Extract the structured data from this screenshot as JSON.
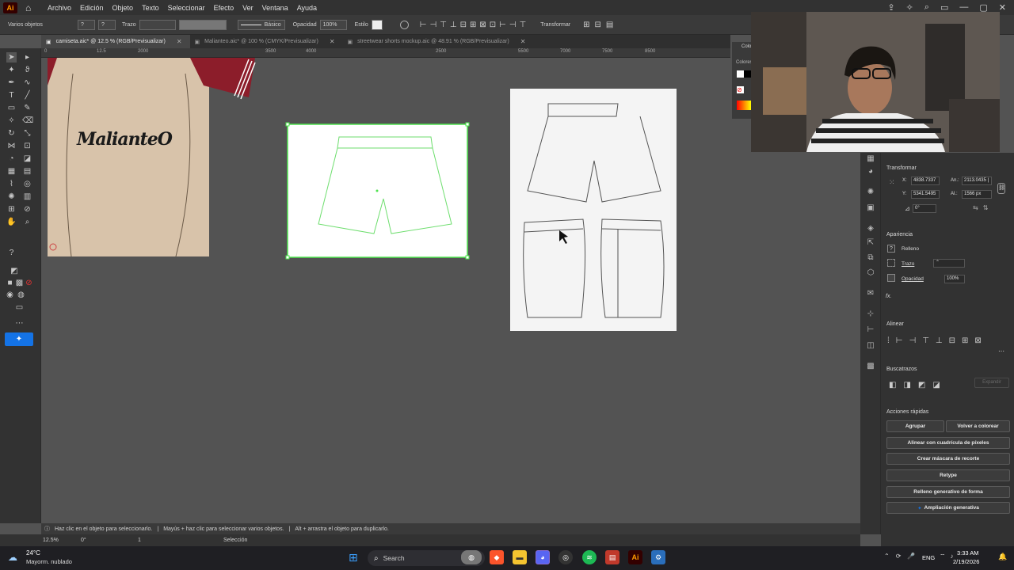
{
  "app": {
    "logo": "Ai",
    "menu": [
      "Archivo",
      "Edición",
      "Objeto",
      "Texto",
      "Seleccionar",
      "Efecto",
      "Ver",
      "Ventana",
      "Ayuda"
    ]
  },
  "control_bar": {
    "selection_label": "Varios objetos",
    "stroke_label": "Trazo",
    "stroke_style": "Básico",
    "opacity_label": "Opacidad",
    "opacity_value": "100%",
    "style_label": "Estilo",
    "transform_label": "Transformar"
  },
  "tabs": [
    {
      "label": "camiseta.aic* @ 12.5 % (RGB/Previsualizar)",
      "active": true
    },
    {
      "label": "Malianteo.aic* @ 100 % (CMYK/Previsualizar)",
      "active": false
    },
    {
      "label": "streetwear shorts mockup.aic @ 48.91 % (RGB/Previsualizar)",
      "active": false
    }
  ],
  "ruler_ticks": [
    "0",
    "12.5",
    "2000",
    "3500",
    "4000",
    "2500",
    "5500",
    "7000",
    "7500",
    "8500"
  ],
  "canvas": {
    "tshirt_brand": "MalianteO"
  },
  "color_panel": {
    "title": "Colo",
    "label": "Colores"
  },
  "properties": {
    "transform": {
      "title": "Transformar",
      "x_label": "X:",
      "x_value": "4838.7337",
      "y_label": "Y:",
      "y_value": "5341.5495",
      "w_label": "An.:",
      "w_value": "2113.0435 |",
      "h_label": "Al.:",
      "h_value": "1566 px",
      "angle_value": "0°"
    },
    "appearance": {
      "title": "Apariencia",
      "fill_label": "Relleno",
      "stroke_label": "Trazo",
      "opacity_label": "Opacidad",
      "opacity_value": "100%",
      "fx_label": "fx."
    },
    "align": {
      "title": "Alinear"
    },
    "pathfinder": {
      "title": "Buscatrazos",
      "expand_label": "Expandir"
    },
    "quick_actions": {
      "title": "Acciones rápidas",
      "group": "Agrupar",
      "recolor": "Volver a colorear",
      "align_pixel": "Alinear con cuadrícula de píxeles",
      "clip_mask": "Crear máscara de recorte",
      "retype": "Retype",
      "gen_fill": "Relleno generativo de forma",
      "gen_expand": "Ampliación generativa"
    }
  },
  "status": {
    "hint": "Haz clic en el objeto para seleccionarlo.",
    "hint2": "Mayús + haz clic para seleccionar varios objetos.",
    "hint3": "Alt + arrastra el objeto para duplicarlo.",
    "zoom": "12.5%",
    "rotation": "0°",
    "artboard": "1",
    "tool": "Selección"
  },
  "taskbar": {
    "weather_temp": "24°C",
    "weather_desc": "Mayorm. nublado",
    "search": "Search",
    "lang": "ENG",
    "time": "3:33 AM",
    "date": "2/19/2026"
  },
  "colors": {
    "accent": "#1473e6",
    "selection": "#4ee34e",
    "tshirt": "#d8c3aa",
    "sleeve": "#8c1d2a"
  }
}
